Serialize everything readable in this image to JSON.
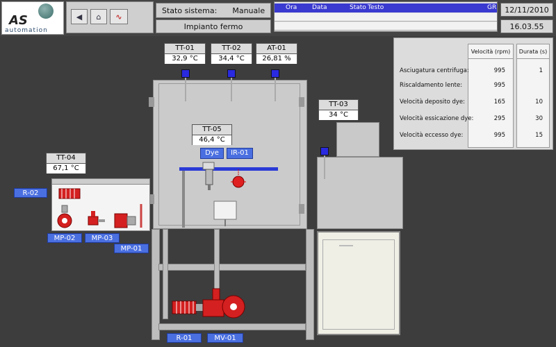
{
  "brand": {
    "name": "AS",
    "subtitle": "automation"
  },
  "toolbar": {
    "back_label": "◀",
    "home_label": "⌂",
    "trend_label": "∿"
  },
  "status": {
    "label": "Stato sistema:",
    "value": "Manuale",
    "message": "Impianto fermo"
  },
  "log": {
    "columns": [
      "Ora",
      "Data",
      "Stato",
      "Testo",
      "GR"
    ]
  },
  "datetime": {
    "date": "12/11/2010",
    "time": "16.03.55"
  },
  "sensors": {
    "tt01": {
      "name": "TT-01",
      "value": "32,9  °C"
    },
    "tt02": {
      "name": "TT-02",
      "value": "34,4  °C"
    },
    "at01": {
      "name": "AT-01",
      "value": "26,81  %"
    },
    "tt03": {
      "name": "TT-03",
      "value": "34  °C"
    },
    "tt04": {
      "name": "TT-04",
      "value": "67,1  °C"
    },
    "tt05": {
      "name": "TT-05",
      "value": "46,4  °C"
    }
  },
  "devices": {
    "dye": "Dye",
    "ir01": "IR-01",
    "r02": "R-02",
    "mp02": "MP-02",
    "mp03": "MP-03",
    "mp01": "MP-01",
    "r01": "R-01",
    "mv01": "MV-01"
  },
  "params": {
    "header_speed": "Velocità (rpm)",
    "header_duration": "Durata (s)",
    "rows": [
      {
        "label": "Asciugatura centrifuga:",
        "speed": "995",
        "duration": "1"
      },
      {
        "label": "Riscaldamento lente:",
        "speed": "995",
        "duration": ""
      },
      {
        "label": "Velocità deposito dye:",
        "speed": "165",
        "duration": "10"
      },
      {
        "label": "Velocità essicazione dye:",
        "speed": "295",
        "duration": "30"
      },
      {
        "label": "Velocità eccesso dye:",
        "speed": "995",
        "duration": "15"
      }
    ]
  },
  "colors": {
    "accent_blue": "#4a6fe0",
    "log_header": "#3a3ad0",
    "pump_red": "#d42020"
  }
}
